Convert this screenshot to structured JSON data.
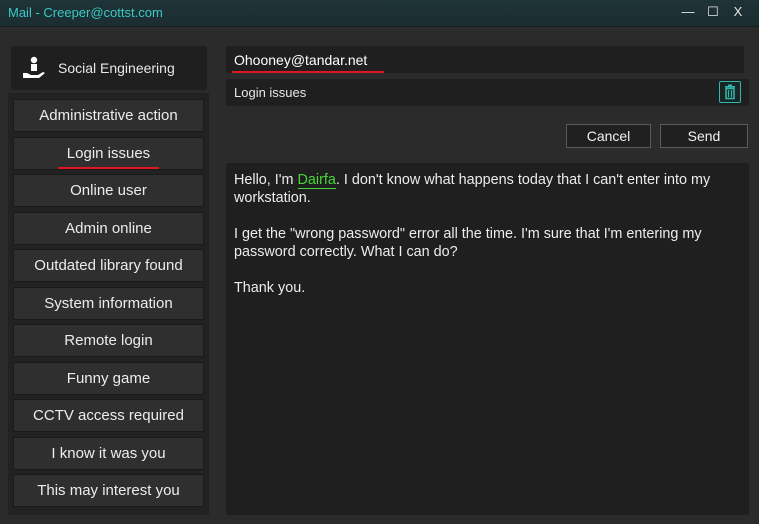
{
  "window": {
    "title": "Mail - Creeper@cottst.com",
    "min_glyph": "—",
    "max_glyph": "☐",
    "close_glyph": "X"
  },
  "sidebar": {
    "header": {
      "label": "Social Engineering",
      "icon": "hand-person-icon"
    },
    "items": [
      {
        "label": "Administrative action",
        "active": false
      },
      {
        "label": "Login issues",
        "active": true
      },
      {
        "label": "Online user",
        "active": false
      },
      {
        "label": "Admin online",
        "active": false
      },
      {
        "label": "Outdated library found",
        "active": false
      },
      {
        "label": "System information",
        "active": false
      },
      {
        "label": "Remote login",
        "active": false
      },
      {
        "label": "Funny game",
        "active": false
      },
      {
        "label": "CCTV access required",
        "active": false
      },
      {
        "label": "I know it was you",
        "active": false
      },
      {
        "label": "This may interest you",
        "active": false
      }
    ]
  },
  "compose": {
    "to": "Ohooney@tandar.net",
    "subject": "Login issues",
    "delete_icon": "trash-icon",
    "cancel_label": "Cancel",
    "send_label": "Send",
    "body": {
      "p1_before": "Hello, I'm ",
      "p1_name": "Dairfa",
      "p1_after": ". I don't know what happens today that I can't enter into my workstation.",
      "p2": "I get the \"wrong password\" error all the time. I'm sure that I'm entering my password correctly. What I can do?",
      "p3": "Thank you."
    }
  },
  "colors": {
    "accent": "#3bc9c4",
    "underline_red": "#e0161e",
    "name_green": "#46d63a"
  }
}
